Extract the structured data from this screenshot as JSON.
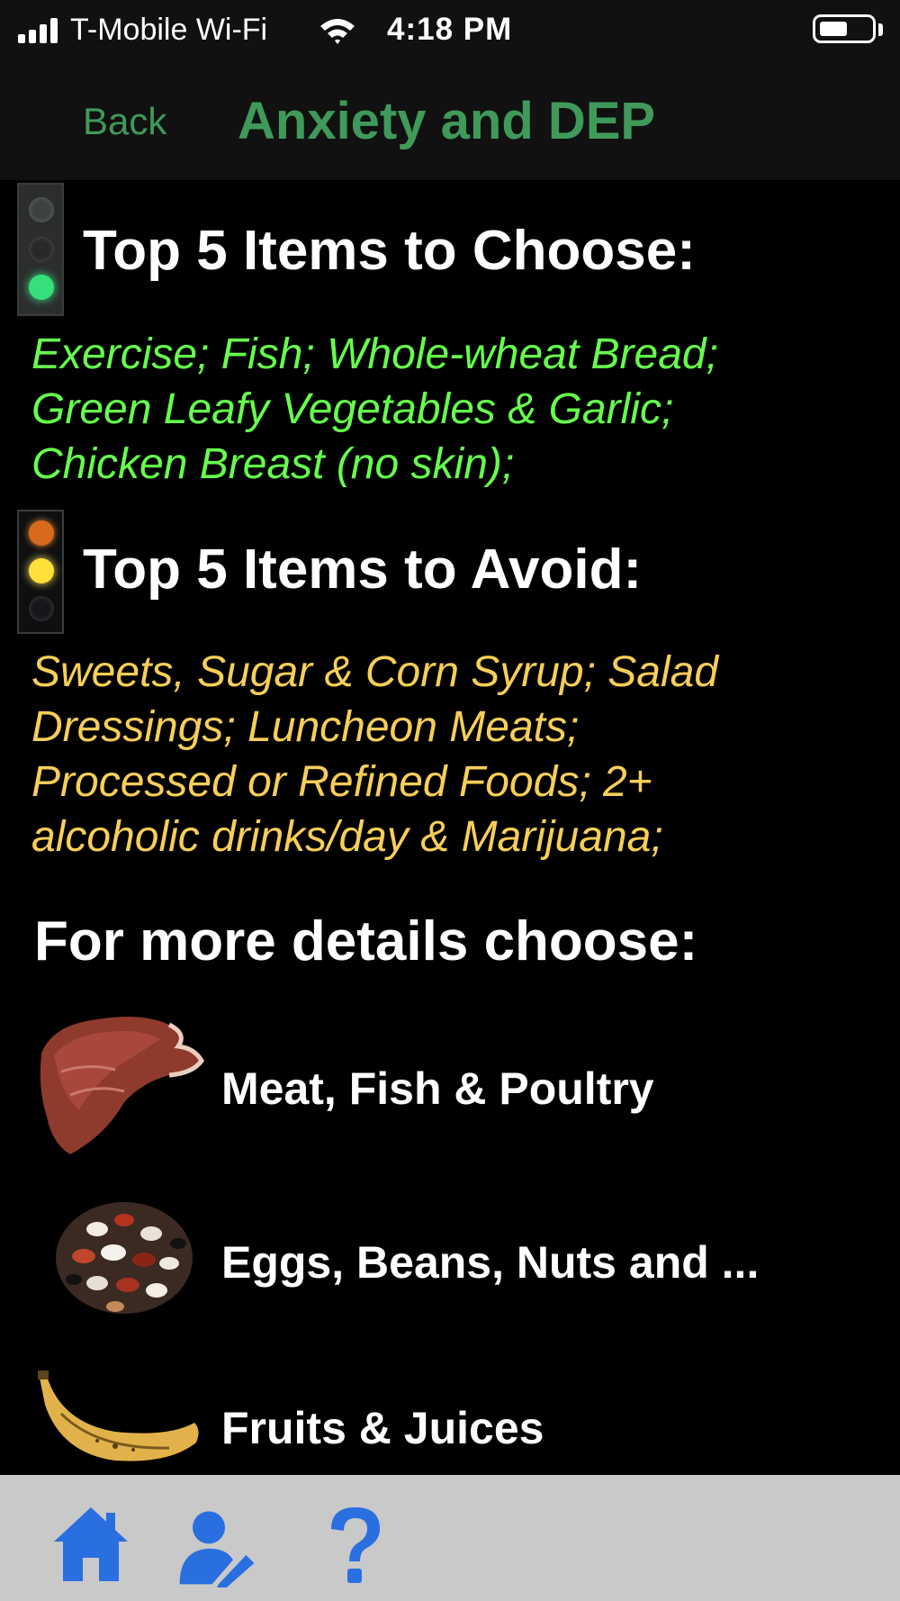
{
  "status_bar": {
    "carrier": "T-Mobile Wi-Fi",
    "time": "4:18 PM",
    "battery_level": 0.55
  },
  "nav": {
    "back_label": "Back",
    "title": "Anxiety and DEP"
  },
  "choose": {
    "heading": "Top 5 Items to Choose:",
    "lines": [
      "Exercise; Fish; Whole-wheat Bread;",
      "Green Leafy Vegetables & Garlic;",
      "Chicken Breast (no skin);"
    ]
  },
  "avoid": {
    "heading": "Top 5 Items to Avoid:",
    "lines": [
      "Sweets, Sugar & Corn Syrup;  Salad",
      "Dressings; Luncheon Meats;",
      "Processed or Refined Foods; 2+",
      "alcoholic drinks/day & Marijuana;"
    ]
  },
  "details": {
    "heading": "For more details choose:",
    "items": [
      {
        "label": "Meat, Fish & Poultry",
        "icon": "steak-icon"
      },
      {
        "label": "Eggs, Beans, Nuts and ...",
        "icon": "beans-icon"
      },
      {
        "label": "Fruits & Juices",
        "icon": "banana-icon"
      }
    ]
  },
  "tab_bar": {
    "tabs": [
      {
        "icon": "home-icon"
      },
      {
        "icon": "edit-profile-icon"
      },
      {
        "icon": "help-icon"
      }
    ]
  },
  "colors": {
    "nav_green": "#3f9a59",
    "choose_green": "#66ff4d",
    "avoid_yellow": "#f7ce58",
    "tab_icon_blue": "#2a6fe0",
    "tab_bar_bg": "#c9c9c9"
  }
}
